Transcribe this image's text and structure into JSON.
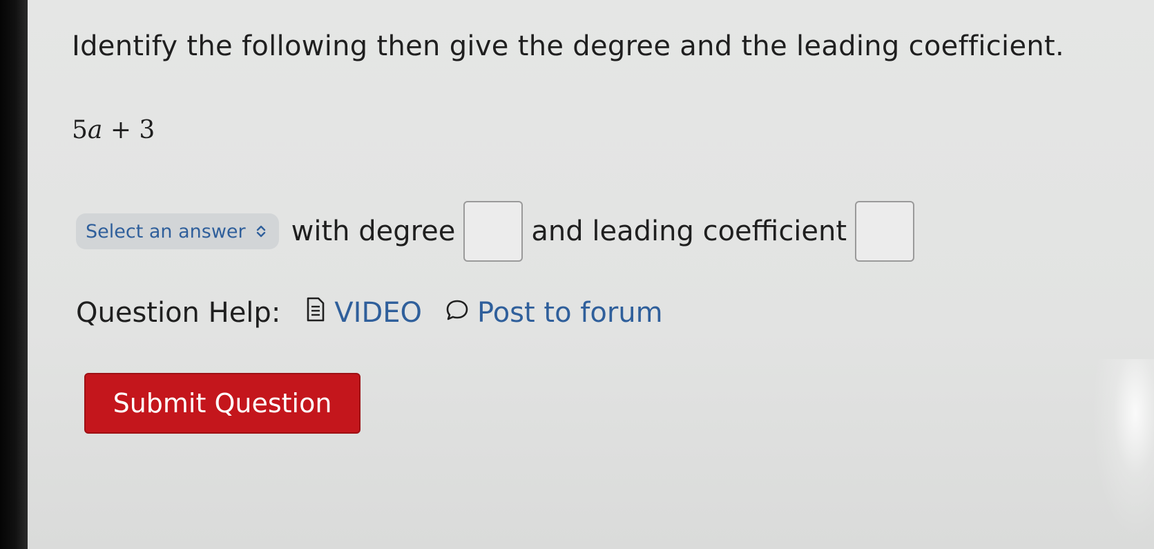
{
  "question": {
    "instruction": "Identify the following then give the degree and the leading coefficient.",
    "expression": {
      "coefficient": "5",
      "variable": "a",
      "rest": " + 3"
    }
  },
  "answer_row": {
    "select_placeholder": "Select an answer",
    "with_degree_text": "with degree",
    "degree_value": "",
    "and_leading_text": "and leading coefficient",
    "leading_value": ""
  },
  "help": {
    "label": "Question Help:",
    "video_label": "VIDEO",
    "forum_label": "Post to forum"
  },
  "submit_label": "Submit Question",
  "colors": {
    "link": "#2f5f9b",
    "submit_bg": "#c4161c"
  }
}
